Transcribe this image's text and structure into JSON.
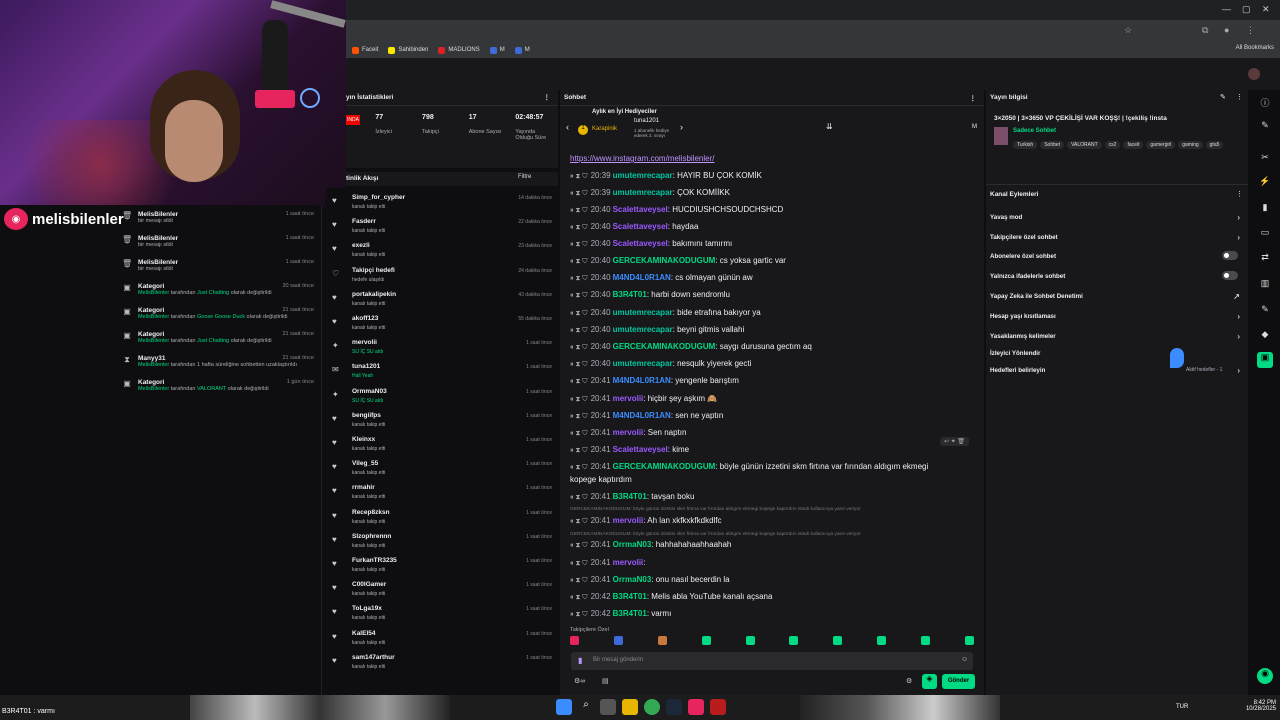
{
  "streamer": {
    "name": "melisbilenler"
  },
  "bookmarks": {
    "items": [
      {
        "label": "Faceit",
        "color": "#ff5500"
      },
      {
        "label": "Sahibinden",
        "color": "#ffe800"
      },
      {
        "label": "MADLIONS",
        "color": "#d22"
      },
      {
        "label": "M",
        "color": "#3f6bd8"
      },
      {
        "label": "M",
        "color": "#3f6bd8"
      }
    ],
    "all": "All Bookmarks"
  },
  "stats": {
    "title": "yın İstatistikleri",
    "live": "INDA",
    "items": [
      {
        "value": "77",
        "label": "İzleyici"
      },
      {
        "value": "798",
        "label": "Takipçi"
      },
      {
        "value": "17",
        "label": "Abone Sayısı"
      },
      {
        "value": "02:48:57",
        "label": "Yayında Olduğu Süre"
      }
    ]
  },
  "activity_left": [
    {
      "title": "MelisBilenler",
      "sub": "bir mesajı sildi",
      "time": "1 saat önce",
      "icon": "trash-icon"
    },
    {
      "title": "MelisBilenler",
      "sub": "bir mesajı sildi",
      "time": "1 saat önce",
      "icon": "trash-icon"
    },
    {
      "title": "MelisBilenler",
      "sub": "bir mesajı sildi",
      "time": "1 saat önce",
      "icon": "trash-icon"
    },
    {
      "title": "Kategori",
      "sub_pre": "MelisBilenler",
      "sub_mid": " tarafından ",
      "sub_hl": "Just Chatting",
      "sub_post": " olarak değiştirildi",
      "time": "20 saat önce",
      "icon": "category-icon"
    },
    {
      "title": "Kategori",
      "sub_pre": "MelisBilenler",
      "sub_mid": " tarafından ",
      "sub_hl": "Goose Goose Duck",
      "sub_post": " olarak değiştirildi",
      "time": "21 saat önce",
      "icon": "category-icon"
    },
    {
      "title": "Kategori",
      "sub_pre": "MelisBilenler",
      "sub_mid": " tarafından ",
      "sub_hl": "Just Chatting",
      "sub_post": " olarak değiştirildi",
      "time": "21 saat önce",
      "icon": "category-icon"
    },
    {
      "title": "Manyy31",
      "sub_pre": "MelisBilenler",
      "sub_mid": " tarafından 1 hafta süreliğine sohbetten uzaklaştırıldı",
      "sub_hl": "",
      "sub_post": "",
      "time": "21 saat önce",
      "icon": "hourglass-icon"
    },
    {
      "title": "Kategori",
      "sub_pre": "MelisBilenler",
      "sub_mid": " tarafından ",
      "sub_hl": "VALORANT",
      "sub_post": " olarak değiştirildi",
      "time": "1 gün önce",
      "icon": "category-icon"
    }
  ],
  "feed": {
    "title": "tinlik Akışı",
    "filter": "Filtre",
    "items": [
      {
        "name": "Simp_for_cypher",
        "sub": "kanalı takip etti",
        "time": "14 dakika önce",
        "icon": "heart-icon"
      },
      {
        "name": "Fasderr",
        "sub": "kanalı takip etti",
        "time": "22 dakika önce",
        "icon": "heart-icon"
      },
      {
        "name": "exezli",
        "sub": "kanalı takip etti",
        "time": "23 dakika önce",
        "icon": "heart-icon"
      },
      {
        "name": "Takipçi hedefi",
        "sub": "hedefe ulaşıldı",
        "time": "24 dakika önce",
        "icon": "heart-outline-icon"
      },
      {
        "name": "portakalipekin",
        "sub": "kanalı takip etti",
        "time": "43 dakika önce",
        "icon": "heart-icon"
      },
      {
        "name": "akoff123",
        "sub": "kanalı takip etti",
        "time": "55 dakika önce",
        "icon": "heart-icon"
      },
      {
        "name": "mervolii",
        "sub": "SU İÇ SU aldı",
        "time": "1 saat önce",
        "icon": "reward-icon",
        "green": true
      },
      {
        "name": "tuna1201",
        "sub": "Hall Yeah",
        "time": "1 saat önce",
        "icon": "gift-icon",
        "green": true
      },
      {
        "name": "OrmmaN03",
        "sub": "SU İÇ SU aldı",
        "time": "1 saat önce",
        "icon": "reward-icon",
        "green": true
      },
      {
        "name": "bengiifps",
        "sub": "kanalı takip etti",
        "time": "1 saat önce",
        "icon": "heart-icon"
      },
      {
        "name": "Kleinxx",
        "sub": "kanalı takip etti",
        "time": "1 saat önce",
        "icon": "heart-icon"
      },
      {
        "name": "Vileg_55",
        "sub": "kanalı takip etti",
        "time": "1 saat önce",
        "icon": "heart-icon"
      },
      {
        "name": "rrmahir",
        "sub": "kanalı takip etti",
        "time": "1 saat önce",
        "icon": "heart-icon"
      },
      {
        "name": "Recep8zksn",
        "sub": "kanalı takip etti",
        "time": "1 saat önce",
        "icon": "heart-icon"
      },
      {
        "name": "Slzophrennn",
        "sub": "kanalı takip etti",
        "time": "1 saat önce",
        "icon": "heart-icon"
      },
      {
        "name": "FurkanTR3235",
        "sub": "kanalı takip etti",
        "time": "1 saat önce",
        "icon": "heart-icon"
      },
      {
        "name": "C00lGamer",
        "sub": "kanalı takip etti",
        "time": "1 saat önce",
        "icon": "heart-icon"
      },
      {
        "name": "ToLga19x",
        "sub": "kanalı takip etti",
        "time": "1 saat önce",
        "icon": "heart-icon"
      },
      {
        "name": "KalEl54",
        "sub": "kanalı takip etti",
        "time": "1 saat önce",
        "icon": "heart-icon"
      },
      {
        "name": "sam147arthur",
        "sub": "kanalı takip etti",
        "time": "1 saat önce",
        "icon": "heart-icon"
      }
    ]
  },
  "chat": {
    "title": "Sohbet",
    "gifters_title": "Aylık en İyi Hediyeciler",
    "gifter1": "Karapinik",
    "gifter2": "tuna1201",
    "gifter2_sub": "1 abonelik hediye ederek 2. sırayı",
    "link": "https://www.instagram.com/melisbilenler/",
    "messages": [
      {
        "time": "20:39",
        "user": "umutemrecapar",
        "color": "#00c8a0",
        "text": "HAYIR BU ÇOK KOMİK"
      },
      {
        "time": "20:39",
        "user": "umutemrecapar",
        "color": "#00c8a0",
        "text": "ÇOK KOMİİKK"
      },
      {
        "time": "20:40",
        "user": "Scalettaveysel",
        "color": "#9b59ff",
        "text": "HUCDIUSHCHSOUDCHSHCD"
      },
      {
        "time": "20:40",
        "user": "Scalettaveysel",
        "color": "#9b59ff",
        "text": "haydaa"
      },
      {
        "time": "20:40",
        "user": "Scalettaveysel",
        "color": "#9b59ff",
        "text": "bakımını tamırmı"
      },
      {
        "time": "20:40",
        "user": "GERCEKAMINAKODUGUM",
        "color": "#00db84",
        "text": "cs yoksa gartic var"
      },
      {
        "time": "20:40",
        "user": "M4ND4L0R1AN",
        "color": "#3b8cff",
        "text": "cs olmayan günün aw"
      },
      {
        "time": "20:40",
        "user": "B3R4T01",
        "color": "#00db84",
        "text": "harbi down sendromlu"
      },
      {
        "time": "20:40",
        "user": "umutemrecapar",
        "color": "#00c8a0",
        "text": "bide etrafına bakıyor ya"
      },
      {
        "time": "20:40",
        "user": "umutemrecapar",
        "color": "#00c8a0",
        "text": "beyni gitmis vallahi"
      },
      {
        "time": "20:40",
        "user": "GERCEKAMINAKODUGUM",
        "color": "#00db84",
        "text": "saygı durusuna gectım aq"
      },
      {
        "time": "20:40",
        "user": "umutemrecapar",
        "color": "#00c8a0",
        "text": "nesqulk yiyerek gecti"
      },
      {
        "time": "20:41",
        "user": "M4ND4L0R1AN",
        "color": "#3b8cff",
        "text": "yengenle barıştım"
      },
      {
        "time": "20:41",
        "user": "mervolii",
        "color": "#9b59ff",
        "text": "hiçbir şey aşkım 🙈"
      },
      {
        "time": "20:41",
        "user": "M4ND4L0R1AN",
        "color": "#3b8cff",
        "text": "sen ne yaptın"
      },
      {
        "time": "20:41",
        "user": "mervolii",
        "color": "#9b59ff",
        "text": "Sen naptın"
      },
      {
        "time": "20:41",
        "user": "Scalettaveysel",
        "color": "#9b59ff",
        "text": "kime"
      },
      {
        "time": "20:41",
        "user": "GERCEKAMINAKODUGUM",
        "color": "#00db84",
        "text": "böyle günün izzetini skm firtına var fırından aldıgım ekmegi"
      },
      {
        "time": "",
        "user": "",
        "color": "#efeff1",
        "text": "kopege kaptırdım"
      },
      {
        "time": "20:41",
        "user": "B3R4T01",
        "color": "#00db84",
        "text": "tavşan boku"
      },
      {
        "time": "20:41",
        "user": "mervolii",
        "color": "#9b59ff",
        "text": "Ah lan xkfkxkfkdkdlfc"
      },
      {
        "time": "20:41",
        "user": "OrrmaN03",
        "color": "#00db84",
        "text": "hahhahahaahhaahah"
      },
      {
        "time": "20:41",
        "user": "mervolii",
        "color": "#9b59ff",
        "text": ""
      },
      {
        "time": "20:41",
        "user": "OrrmaN03",
        "color": "#00db84",
        "text": "onu nasıl becerdin la"
      },
      {
        "time": "20:42",
        "user": "B3R4T01",
        "color": "#00db84",
        "text": "Melis abla YouTube kanalı açsana"
      },
      {
        "time": "20:42",
        "user": "B3R4T01",
        "color": "#00db84",
        "text": "varmı"
      }
    ],
    "reply1": "GERCEKAMINAKODUGUM: böyle günün izzetini skm firtına var fırından aldıgım ekmegi kopege kaptırdım istedi kullanıcıya yanıt veriyor",
    "reply2": "GERCEKAMINAKODUGUM: böyle günün izzetini skm firtına var fırından aldıgım ekmegi kopege kaptırdım istedi kullanıcıya yanıt veriyor",
    "followers_only": "Takipçilere Özel",
    "placeholder": "Bir mesaj gönderin",
    "send": "Gönder"
  },
  "stream_info": {
    "title": "Yayın bilgisi",
    "stream_title": "3×2050 | 3×3650 VP ÇEKİLİŞİ VAR KOŞŞ! | !çekiliş !insta",
    "category": "Sadece Sohbet",
    "tags": [
      "Turkish",
      "Sohbet",
      "VALORANT",
      "cs2",
      "faceit",
      "gamergirl",
      "gaming",
      "gta5"
    ]
  },
  "channel_actions": {
    "title": "Kanal Eylemleri",
    "items": [
      {
        "label": "Yavaş mod",
        "ctl": "›"
      },
      {
        "label": "Takipçilere özel sohbet",
        "ctl": "›"
      },
      {
        "label": "Abonelere özel sohbet",
        "ctl": "toggle"
      },
      {
        "label": "Yalnızca ifadelerle sohbet",
        "ctl": "toggle"
      },
      {
        "label": "Yapay Zeka ile Sohbet Denetimi",
        "ctl": "↗"
      },
      {
        "label": "Hesap yaşı kısıtlaması",
        "ctl": "›"
      },
      {
        "label": "Yasaklanmış kelimeler",
        "ctl": "›"
      },
      {
        "label": "İzleyici Yönlendir",
        "ctl": ""
      },
      {
        "label": "Hedefleri belirleyin",
        "ctl": "›"
      }
    ],
    "goal_note": "Aktif hedefler - 1"
  },
  "taskbar": {
    "bottom_name": "B3R4T01 : varmı",
    "lang": "TUR",
    "time": "8:42 PM",
    "date": "10/28/2025"
  },
  "colors": {
    "accent": "#00db84",
    "bg": "#18181b",
    "bg_dark": "#0e0e10"
  }
}
